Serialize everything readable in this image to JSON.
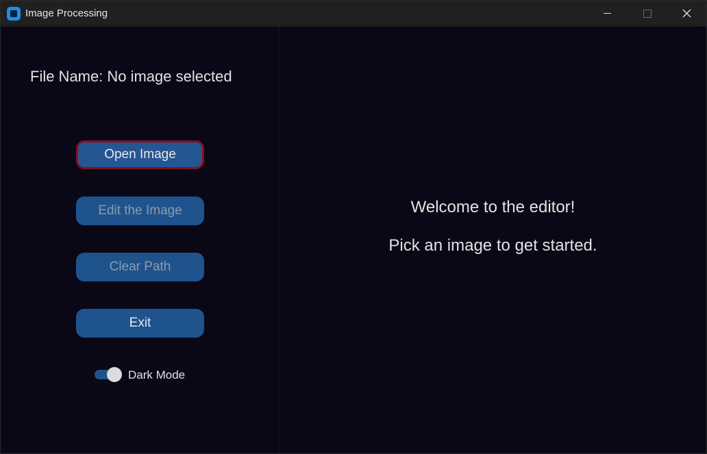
{
  "window": {
    "title": "Image Processing",
    "app_icon": "app-window-icon",
    "controls": {
      "minimize_icon": "minimize-icon",
      "maximize_icon": "maximize-icon",
      "close_icon": "close-icon"
    }
  },
  "sidebar": {
    "file_name_label": "File Name:",
    "file_name_value": "No image selected",
    "buttons": {
      "open": "Open Image",
      "edit": "Edit the Image",
      "clear": "Clear Path",
      "exit": "Exit"
    },
    "dark_mode": {
      "label": "Dark Mode",
      "enabled": true
    }
  },
  "main": {
    "welcome": "Welcome to the editor!",
    "hint": "Pick an image to get started."
  },
  "colors": {
    "background": "#0a0817",
    "button": "#1f538d",
    "focus_border": "#8a0f1a",
    "titlebar": "#202020",
    "accent_icon": "#1f8fe6"
  }
}
